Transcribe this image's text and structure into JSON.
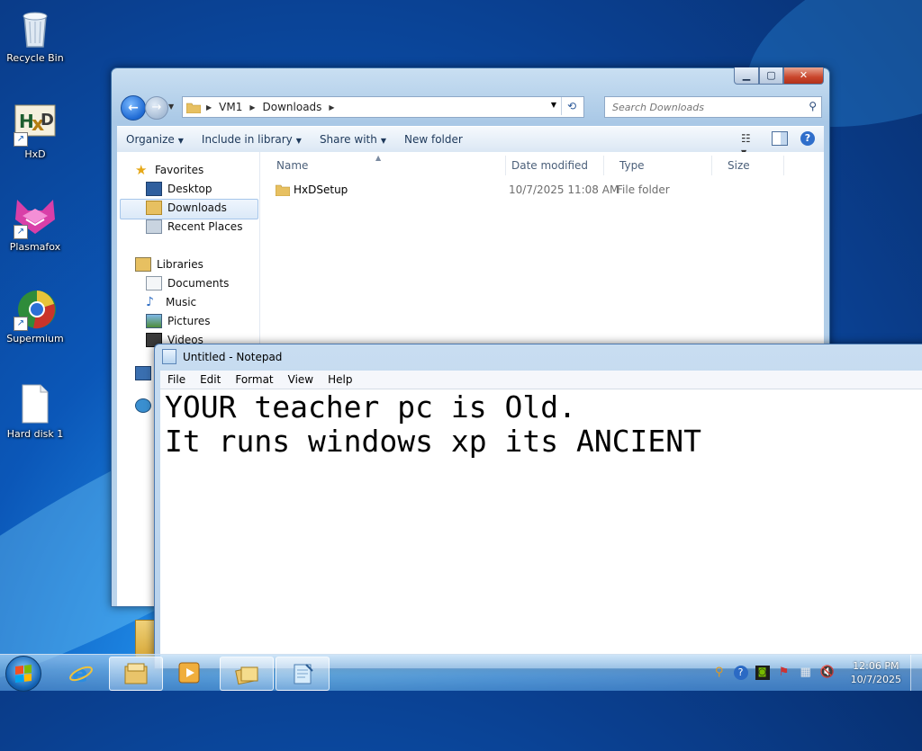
{
  "desktop": {
    "icons": [
      {
        "label": "Recycle Bin",
        "icon": "recycle-bin-icon"
      },
      {
        "label": "HxD",
        "icon": "hxd-icon"
      },
      {
        "label": "Plasmafox",
        "icon": "plasmafox-icon"
      },
      {
        "label": "Supermium",
        "icon": "supermium-icon"
      },
      {
        "label": "Hard disk 1",
        "icon": "blank-file-icon"
      }
    ]
  },
  "explorer": {
    "address": {
      "crumbs": [
        "VM1",
        "Downloads"
      ]
    },
    "search": {
      "placeholder": "Search Downloads"
    },
    "commands": {
      "organize": "Organize",
      "include_in_library": "Include in library",
      "share_with": "Share with",
      "new_folder": "New folder"
    },
    "nav": {
      "favorites": "Favorites",
      "desktop": "Desktop",
      "downloads": "Downloads",
      "recent_places": "Recent Places",
      "libraries": "Libraries",
      "documents": "Documents",
      "music": "Music",
      "pictures": "Pictures",
      "videos": "Videos"
    },
    "columns": {
      "name": "Name",
      "date_modified": "Date modified",
      "type": "Type",
      "size": "Size"
    },
    "files": [
      {
        "name": "HxDSetup",
        "date_modified": "10/7/2025 11:08 AM",
        "type": "File folder",
        "size": ""
      }
    ]
  },
  "notepad": {
    "title": "Untitled - Notepad",
    "menu": {
      "file": "File",
      "edit": "Edit",
      "format": "Format",
      "view": "View",
      "help": "Help"
    },
    "text": "YOUR teacher pc is Old.\nIt runs windows xp its ANCIENT"
  },
  "taskbar": {
    "clock": {
      "time": "12:06 PM",
      "date": "10/7/2025"
    },
    "pinned": [
      "internet-explorer-icon",
      "file-explorer-icon",
      "media-player-icon",
      "folder-stack-icon",
      "notepad-icon"
    ]
  },
  "colors": {
    "accent": "#1e88e5",
    "window_frame": "#a9c8e6",
    "selection": "#dbe9f8"
  }
}
